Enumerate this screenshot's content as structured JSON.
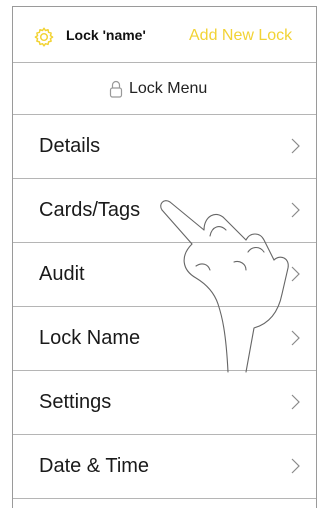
{
  "header": {
    "settings_icon": "gear-icon",
    "lock_name": "Lock 'name'",
    "add_new_lock": "Add New Lock",
    "accent_color": "#f2d335"
  },
  "submenu": {
    "icon": "padlock-icon",
    "label": "Lock Menu"
  },
  "menu": {
    "items": [
      {
        "label": "Details"
      },
      {
        "label": "Cards/Tags"
      },
      {
        "label": "Audit"
      },
      {
        "label": "Lock Name"
      },
      {
        "label": "Settings"
      },
      {
        "label": "Date & Time"
      }
    ],
    "chevron_icon": "chevron-right-icon"
  },
  "overlay": {
    "gesture_icon": "pointing-hand-icon",
    "target": "Cards/Tags"
  }
}
